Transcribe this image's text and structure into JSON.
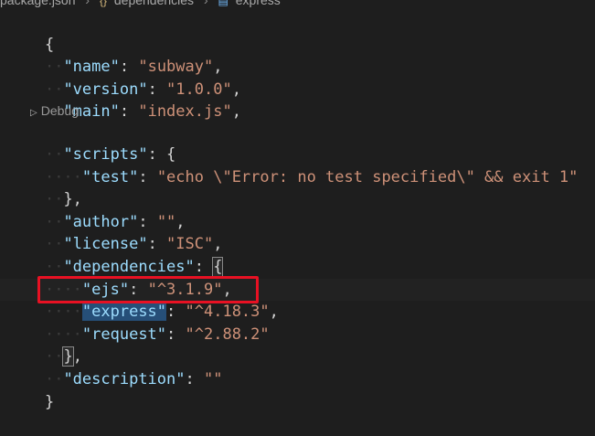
{
  "breadcrumb": {
    "file": "package.json",
    "items": [
      "dependencies",
      "express"
    ]
  },
  "codelens": {
    "label": "Debug"
  },
  "lines": {
    "l1": {
      "open": "{"
    },
    "l2": {
      "key": "\"name\"",
      "colon": ": ",
      "value": "\"subway\"",
      "tail": ","
    },
    "l3": {
      "key": "\"version\"",
      "colon": ": ",
      "value": "\"1.0.0\"",
      "tail": ","
    },
    "l4": {
      "key": "\"main\"",
      "colon": ": ",
      "value": "\"index.js\"",
      "tail": ","
    },
    "l5": {
      "key": "\"scripts\"",
      "colon": ": ",
      "tail": "{"
    },
    "l6": {
      "key": "\"test\"",
      "colon": ": ",
      "value": "\"echo \\\"Error: no test specified\\\" && exit 1\""
    },
    "l7": {
      "close": "},",
      "tail": ""
    },
    "l8": {
      "key": "\"author\"",
      "colon": ": ",
      "value": "\"\"",
      "tail": ","
    },
    "l9": {
      "key": "\"license\"",
      "colon": ": ",
      "value": "\"ISC\"",
      "tail": ","
    },
    "l10": {
      "key": "\"dependencies\"",
      "colon": ": ",
      "tail": "{"
    },
    "l11": {
      "key": "\"ejs\"",
      "colon": ": ",
      "value": "\"^3.1.9\"",
      "tail": ","
    },
    "l12": {
      "key": "\"express\"",
      "colon": ": ",
      "value": "\"^4.18.3\"",
      "tail": ","
    },
    "l13": {
      "key": "\"request\"",
      "colon": ": ",
      "value": "\"^2.88.2\""
    },
    "l14": {
      "close": "}",
      "tail": ","
    },
    "l15": {
      "key": "\"description\"",
      "colon": ": ",
      "value": "\"\""
    },
    "l16": {
      "close": "}"
    }
  },
  "colors": {
    "background": "#1e1e1e",
    "key": "#9cdcfe",
    "string": "#ce9178",
    "highlight": "#264f78",
    "annotation_box": "#e81123"
  }
}
